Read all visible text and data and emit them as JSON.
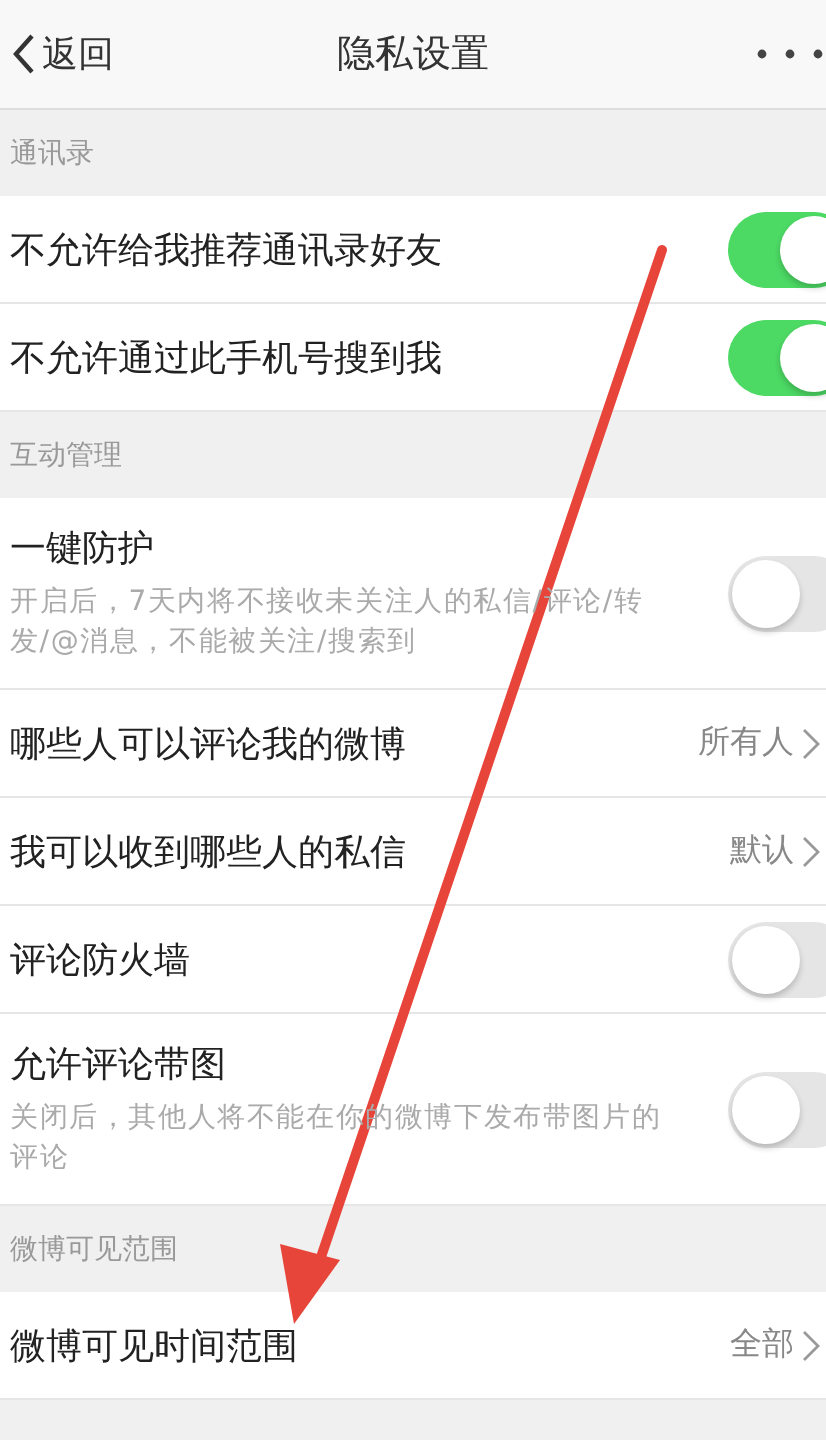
{
  "nav": {
    "back": "返回",
    "title": "隐私设置"
  },
  "sections": [
    {
      "title": "通讯录",
      "items": [
        {
          "kind": "toggle",
          "label": "不允许给我推荐通讯录好友",
          "on": true
        },
        {
          "kind": "toggle",
          "label": "不允许通过此手机号搜到我",
          "on": true
        }
      ]
    },
    {
      "title": "互动管理",
      "items": [
        {
          "kind": "toggle",
          "label": "一键防护",
          "description": "开启后，7天内将不接收未关注人的私信/评论/转发/@消息，不能被关注/搜索到",
          "on": false
        },
        {
          "kind": "link",
          "label": "哪些人可以评论我的微博",
          "value": "所有人"
        },
        {
          "kind": "link",
          "label": "我可以收到哪些人的私信",
          "value": "默认"
        },
        {
          "kind": "toggle",
          "label": "评论防火墙",
          "on": false
        },
        {
          "kind": "toggle",
          "label": "允许评论带图",
          "description": "关闭后，其他人将不能在你的微博下发布带图片的评论",
          "on": false
        }
      ]
    },
    {
      "title": "微博可见范围",
      "items": [
        {
          "kind": "link",
          "label": "微博可见时间范围",
          "value": "全部"
        }
      ]
    }
  ]
}
